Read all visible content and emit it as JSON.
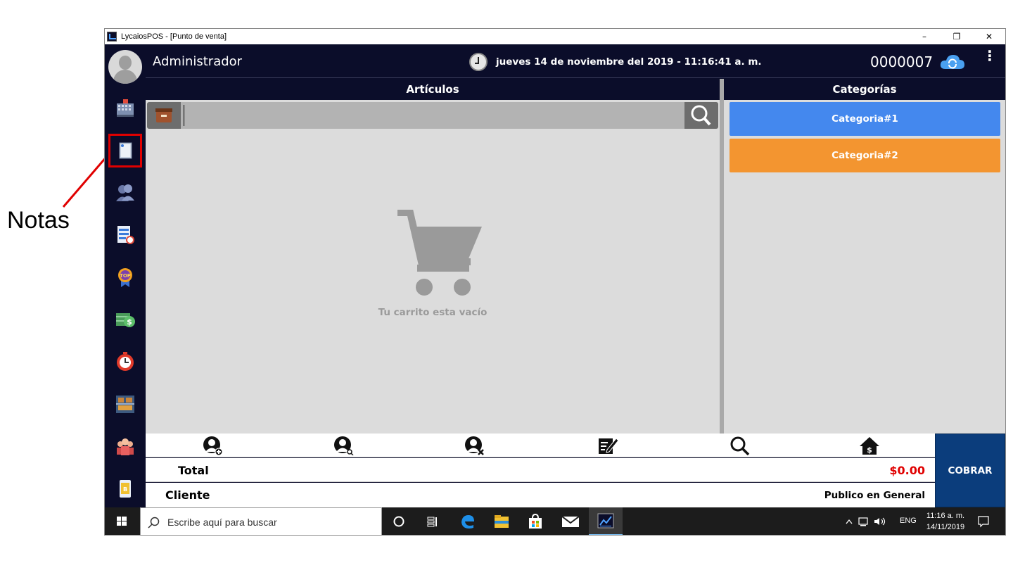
{
  "annotation": {
    "label": "Notas",
    "color": "#e00000"
  },
  "window": {
    "title": "LycaiosPOS - [Punto de venta]",
    "minimize": "–",
    "restore": "❐",
    "close": "✕"
  },
  "header": {
    "user_name": "Administrador",
    "datetime": "jueves 14 de noviembre del 2019 - 11:16:41 a. m.",
    "ticket_number": "0000007",
    "menu_glyph": "⋮"
  },
  "sidebar": {
    "items": [
      {
        "name": "sales-icon"
      },
      {
        "name": "notes-icon"
      },
      {
        "name": "customers-icon"
      },
      {
        "name": "reports-icon"
      },
      {
        "name": "top-icon"
      },
      {
        "name": "cash-icon"
      },
      {
        "name": "timer-icon"
      },
      {
        "name": "inventory-icon"
      },
      {
        "name": "users-icon"
      },
      {
        "name": "mobile-icon"
      }
    ]
  },
  "articles": {
    "title": "Artículos",
    "search_value": "",
    "empty_text": "Tu carrito esta vacío"
  },
  "categories": {
    "title": "Categorías",
    "items": [
      {
        "label": "Categoria#1",
        "color": "#4488ee"
      },
      {
        "label": "Categoria#2",
        "color": "#f39530"
      }
    ]
  },
  "actions": {
    "icons": [
      "add-client-icon",
      "search-client-icon",
      "remove-client-icon",
      "edit-note-icon",
      "search-icon",
      "home-money-icon"
    ]
  },
  "totals": {
    "total_label": "Total",
    "total_value": "$0.00",
    "client_label": "Cliente",
    "client_value": "Publico en General",
    "cobrar_label": "COBRAR"
  },
  "taskbar": {
    "search_placeholder": "Escribe aquí para buscar",
    "lang": "ENG",
    "time": "11:16 a. m.",
    "date": "14/11/2019"
  },
  "colors": {
    "dark": "#0b0d2a",
    "cobrar": "#0b3d7c",
    "accent_red": "#e00000"
  }
}
